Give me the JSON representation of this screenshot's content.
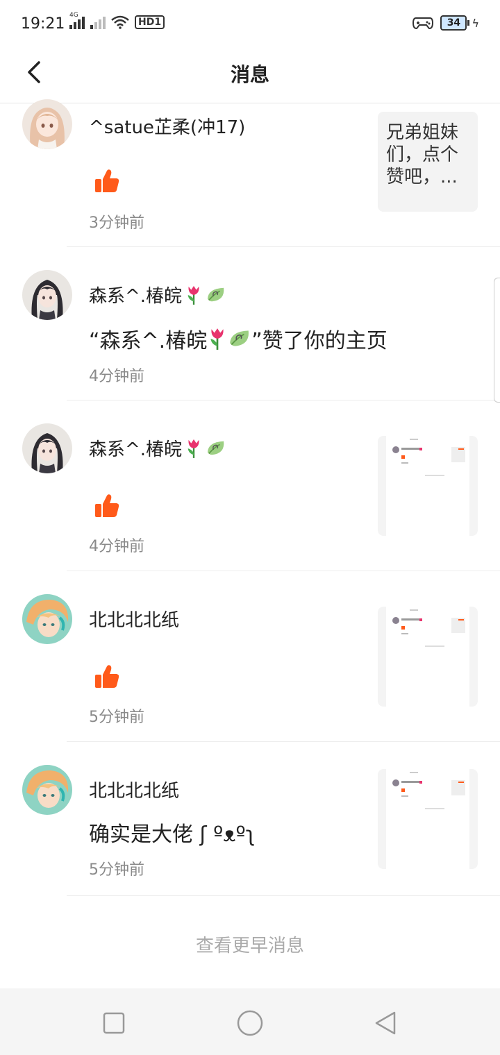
{
  "status_bar": {
    "time": "19:21",
    "network_label": "4G",
    "hd_label": "HD1",
    "battery_level": "34"
  },
  "header": {
    "title": "消息"
  },
  "notifications": [
    {
      "name": "^satue芷柔(冲17)",
      "type": "like",
      "time": "3分钟前",
      "preview_text": "兄弟姐妹们，点个赞吧，..."
    },
    {
      "name": "森系^.椿皖",
      "type": "text",
      "content": "“森系^.椿皖",
      "content_suffix": "”赞了你的主页",
      "time": "4分钟前"
    },
    {
      "name": "森系^.椿皖",
      "type": "like",
      "time": "4分钟前"
    },
    {
      "name": "北北北北纸",
      "type": "like",
      "time": "5分钟前"
    },
    {
      "name": "北北北北纸",
      "type": "text",
      "content": "确实是大佬 ʃ ºᴥºʅ",
      "time": "5分钟前"
    }
  ],
  "more_link": "查看更早消息",
  "colors": {
    "accent_orange": "#ff5a1a",
    "time_gray": "#8a8a8a",
    "divider": "#ededed"
  },
  "icons": {
    "back": "back-arrow-icon",
    "like": "thumbs-up-icon",
    "tulip": "tulip-emoji-icon",
    "leaf": "leaf-emoji-icon",
    "nav_recent": "square-icon",
    "nav_home": "circle-icon",
    "nav_back": "triangle-back-icon"
  }
}
